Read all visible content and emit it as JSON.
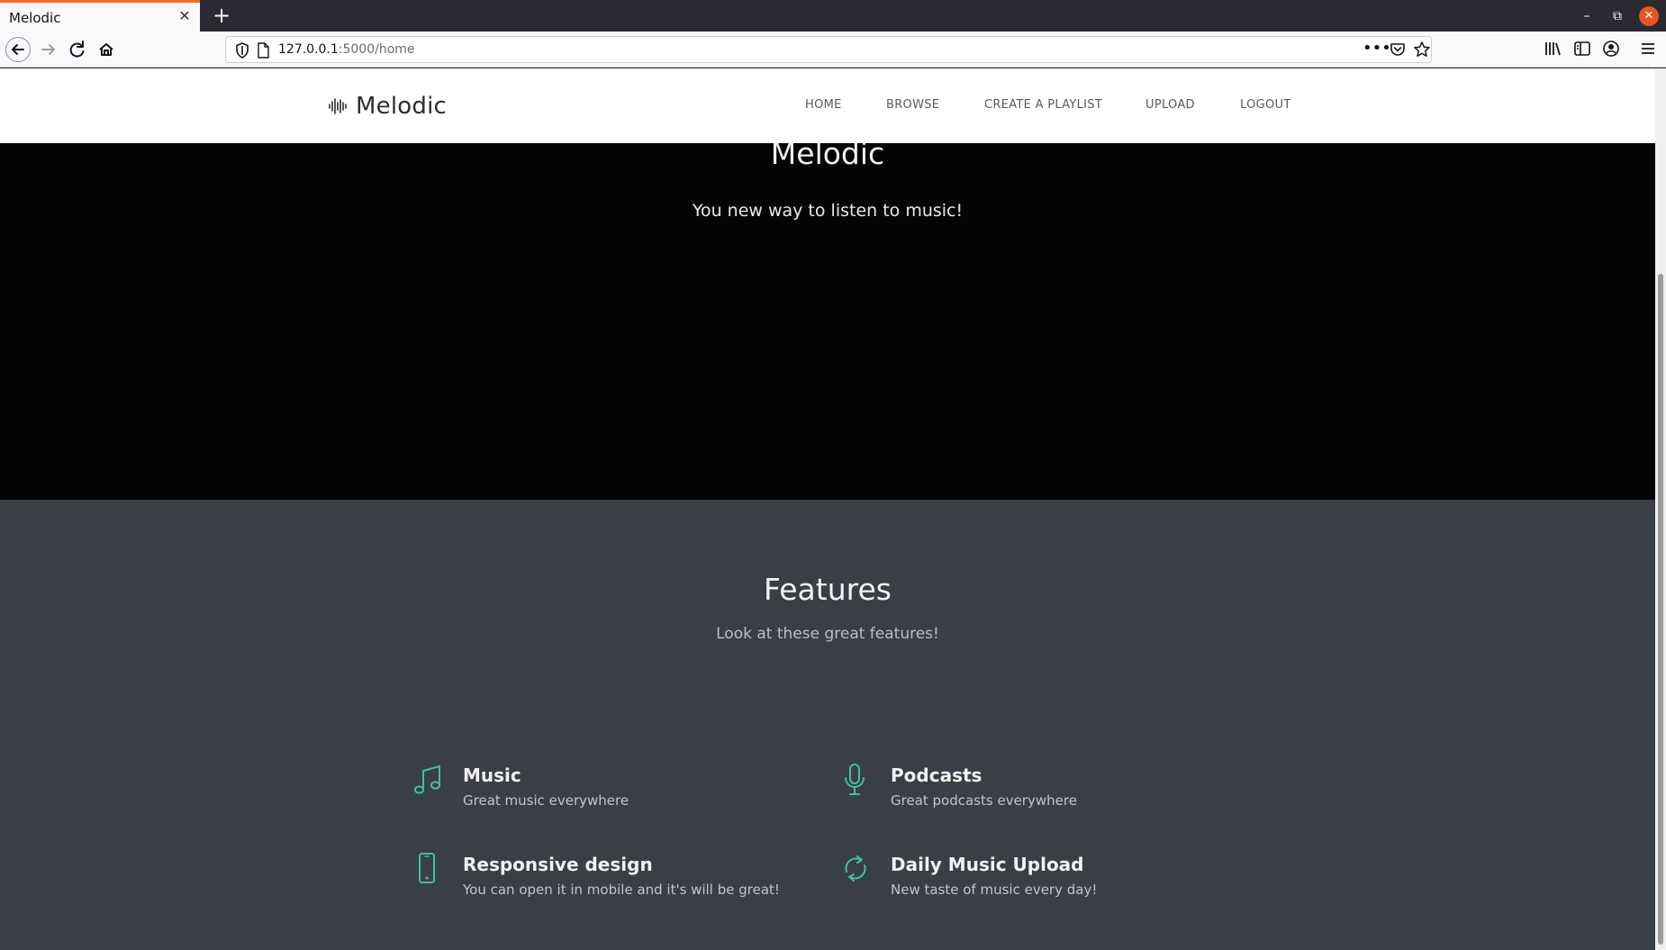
{
  "browser": {
    "tab_title": "Melodic",
    "url_host": "127.0.0.1",
    "url_path": ":5000/home"
  },
  "site": {
    "logo_text": "Melodic",
    "nav": [
      "HOME",
      "BROWSE",
      "CREATE A PLAYLIST",
      "UPLOAD",
      "LOGOUT"
    ]
  },
  "hero": {
    "title": "Melodic",
    "subtitle": "You new way to listen to music!"
  },
  "features": {
    "title": "Features",
    "subtitle": "Look at these great features!",
    "items": [
      {
        "icon": "music-note-icon",
        "title": "Music",
        "desc": "Great music everywhere"
      },
      {
        "icon": "microphone-icon",
        "title": "Podcasts",
        "desc": "Great podcasts everywhere"
      },
      {
        "icon": "mobile-phone-icon",
        "title": "Responsive design",
        "desc": "You can open it in mobile and it's will be great!"
      },
      {
        "icon": "refresh-icon",
        "title": "Daily Music Upload",
        "desc": "New taste of music every day!"
      }
    ]
  },
  "colors": {
    "accent": "#3fc1a0",
    "hero_bg": "#040507",
    "features_bg": "#393e47"
  }
}
